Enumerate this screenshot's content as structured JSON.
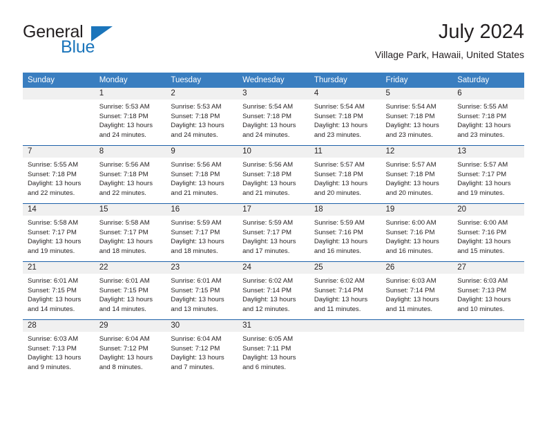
{
  "brand": {
    "name_part1": "General",
    "name_part2": "Blue",
    "logo_icon": "triangle-flag-icon",
    "accent_color": "#1b75bb"
  },
  "header": {
    "month_title": "July 2024",
    "location": "Village Park, Hawaii, United States"
  },
  "calendar": {
    "header_background": "#3a7ec0",
    "daynum_background": "#f0f0f0",
    "row_divider_color": "#1b5fa8",
    "weekday_headers": [
      "Sunday",
      "Monday",
      "Tuesday",
      "Wednesday",
      "Thursday",
      "Friday",
      "Saturday"
    ],
    "weeks": [
      [
        {
          "day": "",
          "empty": true,
          "sunrise": "",
          "sunset": "",
          "daylight_line1": "",
          "daylight_line2": ""
        },
        {
          "day": "1",
          "empty": false,
          "sunrise": "Sunrise: 5:53 AM",
          "sunset": "Sunset: 7:18 PM",
          "daylight_line1": "Daylight: 13 hours",
          "daylight_line2": "and 24 minutes."
        },
        {
          "day": "2",
          "empty": false,
          "sunrise": "Sunrise: 5:53 AM",
          "sunset": "Sunset: 7:18 PM",
          "daylight_line1": "Daylight: 13 hours",
          "daylight_line2": "and 24 minutes."
        },
        {
          "day": "3",
          "empty": false,
          "sunrise": "Sunrise: 5:54 AM",
          "sunset": "Sunset: 7:18 PM",
          "daylight_line1": "Daylight: 13 hours",
          "daylight_line2": "and 24 minutes."
        },
        {
          "day": "4",
          "empty": false,
          "sunrise": "Sunrise: 5:54 AM",
          "sunset": "Sunset: 7:18 PM",
          "daylight_line1": "Daylight: 13 hours",
          "daylight_line2": "and 23 minutes."
        },
        {
          "day": "5",
          "empty": false,
          "sunrise": "Sunrise: 5:54 AM",
          "sunset": "Sunset: 7:18 PM",
          "daylight_line1": "Daylight: 13 hours",
          "daylight_line2": "and 23 minutes."
        },
        {
          "day": "6",
          "empty": false,
          "sunrise": "Sunrise: 5:55 AM",
          "sunset": "Sunset: 7:18 PM",
          "daylight_line1": "Daylight: 13 hours",
          "daylight_line2": "and 23 minutes."
        }
      ],
      [
        {
          "day": "7",
          "empty": false,
          "sunrise": "Sunrise: 5:55 AM",
          "sunset": "Sunset: 7:18 PM",
          "daylight_line1": "Daylight: 13 hours",
          "daylight_line2": "and 22 minutes."
        },
        {
          "day": "8",
          "empty": false,
          "sunrise": "Sunrise: 5:56 AM",
          "sunset": "Sunset: 7:18 PM",
          "daylight_line1": "Daylight: 13 hours",
          "daylight_line2": "and 22 minutes."
        },
        {
          "day": "9",
          "empty": false,
          "sunrise": "Sunrise: 5:56 AM",
          "sunset": "Sunset: 7:18 PM",
          "daylight_line1": "Daylight: 13 hours",
          "daylight_line2": "and 21 minutes."
        },
        {
          "day": "10",
          "empty": false,
          "sunrise": "Sunrise: 5:56 AM",
          "sunset": "Sunset: 7:18 PM",
          "daylight_line1": "Daylight: 13 hours",
          "daylight_line2": "and 21 minutes."
        },
        {
          "day": "11",
          "empty": false,
          "sunrise": "Sunrise: 5:57 AM",
          "sunset": "Sunset: 7:18 PM",
          "daylight_line1": "Daylight: 13 hours",
          "daylight_line2": "and 20 minutes."
        },
        {
          "day": "12",
          "empty": false,
          "sunrise": "Sunrise: 5:57 AM",
          "sunset": "Sunset: 7:18 PM",
          "daylight_line1": "Daylight: 13 hours",
          "daylight_line2": "and 20 minutes."
        },
        {
          "day": "13",
          "empty": false,
          "sunrise": "Sunrise: 5:57 AM",
          "sunset": "Sunset: 7:17 PM",
          "daylight_line1": "Daylight: 13 hours",
          "daylight_line2": "and 19 minutes."
        }
      ],
      [
        {
          "day": "14",
          "empty": false,
          "sunrise": "Sunrise: 5:58 AM",
          "sunset": "Sunset: 7:17 PM",
          "daylight_line1": "Daylight: 13 hours",
          "daylight_line2": "and 19 minutes."
        },
        {
          "day": "15",
          "empty": false,
          "sunrise": "Sunrise: 5:58 AM",
          "sunset": "Sunset: 7:17 PM",
          "daylight_line1": "Daylight: 13 hours",
          "daylight_line2": "and 18 minutes."
        },
        {
          "day": "16",
          "empty": false,
          "sunrise": "Sunrise: 5:59 AM",
          "sunset": "Sunset: 7:17 PM",
          "daylight_line1": "Daylight: 13 hours",
          "daylight_line2": "and 18 minutes."
        },
        {
          "day": "17",
          "empty": false,
          "sunrise": "Sunrise: 5:59 AM",
          "sunset": "Sunset: 7:17 PM",
          "daylight_line1": "Daylight: 13 hours",
          "daylight_line2": "and 17 minutes."
        },
        {
          "day": "18",
          "empty": false,
          "sunrise": "Sunrise: 5:59 AM",
          "sunset": "Sunset: 7:16 PM",
          "daylight_line1": "Daylight: 13 hours",
          "daylight_line2": "and 16 minutes."
        },
        {
          "day": "19",
          "empty": false,
          "sunrise": "Sunrise: 6:00 AM",
          "sunset": "Sunset: 7:16 PM",
          "daylight_line1": "Daylight: 13 hours",
          "daylight_line2": "and 16 minutes."
        },
        {
          "day": "20",
          "empty": false,
          "sunrise": "Sunrise: 6:00 AM",
          "sunset": "Sunset: 7:16 PM",
          "daylight_line1": "Daylight: 13 hours",
          "daylight_line2": "and 15 minutes."
        }
      ],
      [
        {
          "day": "21",
          "empty": false,
          "sunrise": "Sunrise: 6:01 AM",
          "sunset": "Sunset: 7:15 PM",
          "daylight_line1": "Daylight: 13 hours",
          "daylight_line2": "and 14 minutes."
        },
        {
          "day": "22",
          "empty": false,
          "sunrise": "Sunrise: 6:01 AM",
          "sunset": "Sunset: 7:15 PM",
          "daylight_line1": "Daylight: 13 hours",
          "daylight_line2": "and 14 minutes."
        },
        {
          "day": "23",
          "empty": false,
          "sunrise": "Sunrise: 6:01 AM",
          "sunset": "Sunset: 7:15 PM",
          "daylight_line1": "Daylight: 13 hours",
          "daylight_line2": "and 13 minutes."
        },
        {
          "day": "24",
          "empty": false,
          "sunrise": "Sunrise: 6:02 AM",
          "sunset": "Sunset: 7:14 PM",
          "daylight_line1": "Daylight: 13 hours",
          "daylight_line2": "and 12 minutes."
        },
        {
          "day": "25",
          "empty": false,
          "sunrise": "Sunrise: 6:02 AM",
          "sunset": "Sunset: 7:14 PM",
          "daylight_line1": "Daylight: 13 hours",
          "daylight_line2": "and 11 minutes."
        },
        {
          "day": "26",
          "empty": false,
          "sunrise": "Sunrise: 6:03 AM",
          "sunset": "Sunset: 7:14 PM",
          "daylight_line1": "Daylight: 13 hours",
          "daylight_line2": "and 11 minutes."
        },
        {
          "day": "27",
          "empty": false,
          "sunrise": "Sunrise: 6:03 AM",
          "sunset": "Sunset: 7:13 PM",
          "daylight_line1": "Daylight: 13 hours",
          "daylight_line2": "and 10 minutes."
        }
      ],
      [
        {
          "day": "28",
          "empty": false,
          "sunrise": "Sunrise: 6:03 AM",
          "sunset": "Sunset: 7:13 PM",
          "daylight_line1": "Daylight: 13 hours",
          "daylight_line2": "and 9 minutes."
        },
        {
          "day": "29",
          "empty": false,
          "sunrise": "Sunrise: 6:04 AM",
          "sunset": "Sunset: 7:12 PM",
          "daylight_line1": "Daylight: 13 hours",
          "daylight_line2": "and 8 minutes."
        },
        {
          "day": "30",
          "empty": false,
          "sunrise": "Sunrise: 6:04 AM",
          "sunset": "Sunset: 7:12 PM",
          "daylight_line1": "Daylight: 13 hours",
          "daylight_line2": "and 7 minutes."
        },
        {
          "day": "31",
          "empty": false,
          "sunrise": "Sunrise: 6:05 AM",
          "sunset": "Sunset: 7:11 PM",
          "daylight_line1": "Daylight: 13 hours",
          "daylight_line2": "and 6 minutes."
        },
        {
          "day": "",
          "empty": true,
          "sunrise": "",
          "sunset": "",
          "daylight_line1": "",
          "daylight_line2": ""
        },
        {
          "day": "",
          "empty": true,
          "sunrise": "",
          "sunset": "",
          "daylight_line1": "",
          "daylight_line2": ""
        },
        {
          "day": "",
          "empty": true,
          "sunrise": "",
          "sunset": "",
          "daylight_line1": "",
          "daylight_line2": ""
        }
      ]
    ]
  }
}
